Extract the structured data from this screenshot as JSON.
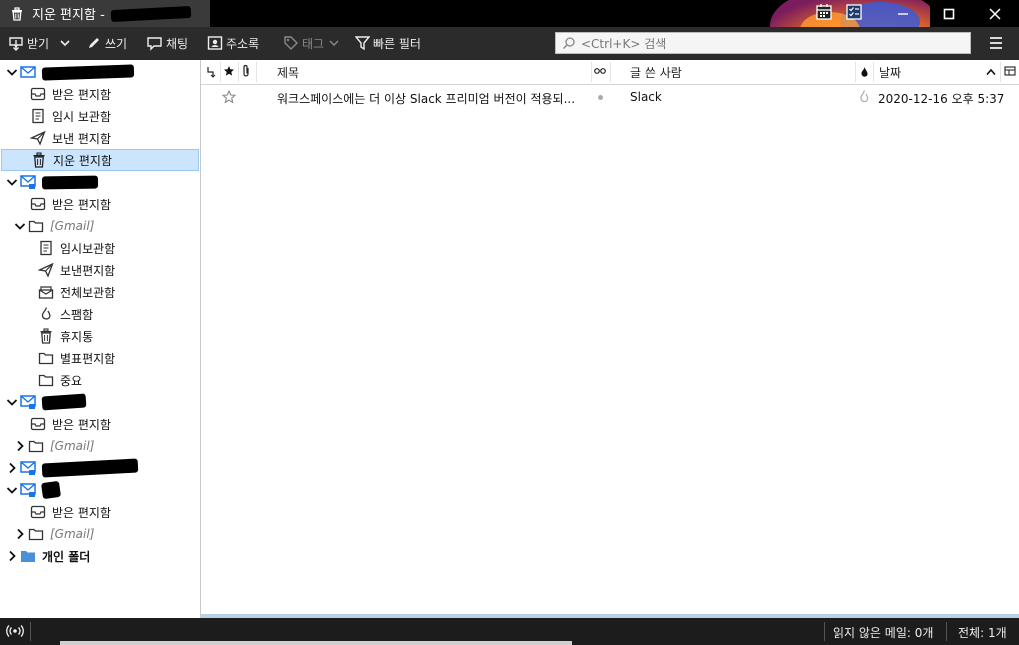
{
  "window": {
    "title": "지운 편지함 -",
    "minimize": "—",
    "maximize": "☐",
    "close": "✕"
  },
  "toolbar": {
    "get_mail": "받기",
    "write": "쓰기",
    "chat": "채팅",
    "address_book": "주소록",
    "tag": "태그",
    "quick_filter": "빠른 필터",
    "search_placeholder": "<Ctrl+K> 검색"
  },
  "folders": {
    "account1": {
      "inbox": "받은 편지함",
      "drafts": "임시 보관함",
      "sent": "보낸 편지함",
      "trash": "지운 편지함"
    },
    "account2": {
      "inbox": "받은 편지함",
      "gmail": "[Gmail]",
      "drafts": "임시보관함",
      "sent": "보낸편지함",
      "all_mail": "전체보관함",
      "spam": "스팸함",
      "trash": "휴지통",
      "starred": "별표편지함",
      "important": "중요"
    },
    "account3": {
      "inbox": "받은 편지함",
      "gmail": "[Gmail]"
    },
    "account5": {
      "inbox": "받은 편지함",
      "gmail": "[Gmail]"
    },
    "local_folders": "개인 폴더"
  },
  "thread_pane": {
    "columns": {
      "subject": "제목",
      "sender": "글 쓴 사람",
      "date": "날짜"
    },
    "messages": [
      {
        "subject": "워크스페이스에는 더 이상 Slack 프리미엄 버전이 적용되...",
        "sender": "Slack",
        "date": "2020-12-16 오후 5:37"
      }
    ]
  },
  "status": {
    "unread": "읽지 않은 메일: 0개",
    "total": "전체: 1개"
  },
  "colors": {
    "selected_bg": "#cce5ff",
    "selected_border": "#99c9ef",
    "toolbar_bg": "#2b2b2b",
    "account_icon": "#1a73e8"
  }
}
